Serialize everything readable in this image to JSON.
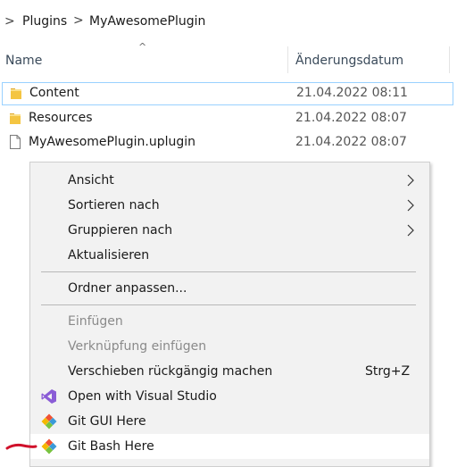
{
  "breadcrumb": {
    "lead_glyph": ">",
    "items": [
      "Plugins",
      "MyAwesomePlugin"
    ],
    "separator": ">"
  },
  "columns": {
    "sort_glyph": "^",
    "name": "Name",
    "date": "Änderungsdatum"
  },
  "files": [
    {
      "name": "Content",
      "date": "21.04.2022 08:11",
      "type": "folder",
      "selected": true
    },
    {
      "name": "Resources",
      "date": "21.04.2022 08:07",
      "type": "folder",
      "selected": false
    },
    {
      "name": "MyAwesomePlugin.uplugin",
      "date": "21.04.2022 08:07",
      "type": "file",
      "selected": false
    }
  ],
  "context_menu": {
    "items": [
      {
        "label": "Ansicht",
        "submenu": true
      },
      {
        "label": "Sortieren nach",
        "submenu": true
      },
      {
        "label": "Gruppieren nach",
        "submenu": true
      },
      {
        "label": "Aktualisieren"
      },
      {
        "label": "Ordner anpassen..."
      },
      {
        "label": "Einfügen",
        "disabled": true
      },
      {
        "label": "Verknüpfung einfügen",
        "disabled": true
      },
      {
        "label": "Verschieben rückgängig machen",
        "shortcut": "Strg+Z"
      },
      {
        "label": "Open with Visual Studio",
        "icon": "visual-studio-icon"
      },
      {
        "label": "Git GUI Here",
        "icon": "git-gui-icon"
      },
      {
        "label": "Git Bash Here",
        "icon": "git-bash-icon",
        "highlighted": true
      }
    ]
  },
  "colors": {
    "folder": "#f4c542",
    "selection_border": "#99d1ff",
    "menu_bg": "#f2f2f2",
    "visual_studio": "#8a5cd6",
    "annotation": "#d0112b"
  }
}
